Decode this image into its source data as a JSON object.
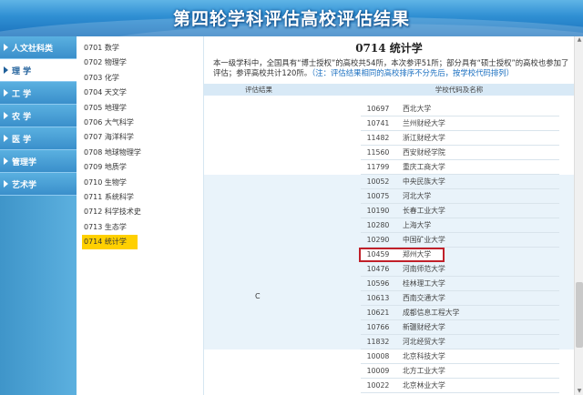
{
  "banner": {
    "title": "第四轮学科评估高校评估结果"
  },
  "sidebar": {
    "items": [
      {
        "label": "人文社科类",
        "active": false
      },
      {
        "label": "理 学",
        "active": true
      },
      {
        "label": "工 学",
        "active": false
      },
      {
        "label": "农 学",
        "active": false
      },
      {
        "label": "医 学",
        "active": false
      },
      {
        "label": "管理学",
        "active": false
      },
      {
        "label": "艺术学",
        "active": false
      }
    ]
  },
  "subjects": [
    "0701 数学",
    "0702 物理学",
    "0703 化学",
    "0704 天文学",
    "0705 地理学",
    "0706 大气科学",
    "0707 海洋科学",
    "0708 地球物理学",
    "0709 地质学",
    "0710 生物学",
    "0711 系统科学",
    "0712 科学技术史",
    "0713 生态学",
    "0714 统计学"
  ],
  "main": {
    "title": "0714 统计学",
    "intro": "本一级学科中，全国具有“博士授权”的高校共54所，本次参评51所；部分具有“硕士授权”的高校也参加了评估；参评高校共计120所。",
    "note": "（注：评估结果相同的高校排序不分先后，按学校代码排列）",
    "col_grade": "评估结果",
    "col_school": "学校代码及名称",
    "grade": "C",
    "rows": [
      {
        "code": "10697",
        "name": "西北大学"
      },
      {
        "code": "10741",
        "name": "兰州财经大学"
      },
      {
        "code": "11482",
        "name": "浙江财经大学"
      },
      {
        "code": "11560",
        "name": "西安财经学院"
      },
      {
        "code": "11799",
        "name": "重庆工商大学"
      },
      {
        "code": "10052",
        "name": "中央民族大学"
      },
      {
        "code": "10075",
        "name": "河北大学"
      },
      {
        "code": "10190",
        "name": "长春工业大学"
      },
      {
        "code": "10280",
        "name": "上海大学"
      },
      {
        "code": "10290",
        "name": "中国矿业大学"
      },
      {
        "code": "10459",
        "name": "郑州大学"
      },
      {
        "code": "10476",
        "name": "河南师范大学"
      },
      {
        "code": "10596",
        "name": "桂林理工大学"
      },
      {
        "code": "10613",
        "name": "西南交通大学"
      },
      {
        "code": "10621",
        "name": "成都信息工程大学"
      },
      {
        "code": "10766",
        "name": "新疆财经大学"
      },
      {
        "code": "11832",
        "name": "河北经贸大学"
      },
      {
        "code": "10008",
        "name": "北京科技大学"
      },
      {
        "code": "10009",
        "name": "北方工业大学"
      },
      {
        "code": "10022",
        "name": "北京林业大学"
      }
    ]
  }
}
